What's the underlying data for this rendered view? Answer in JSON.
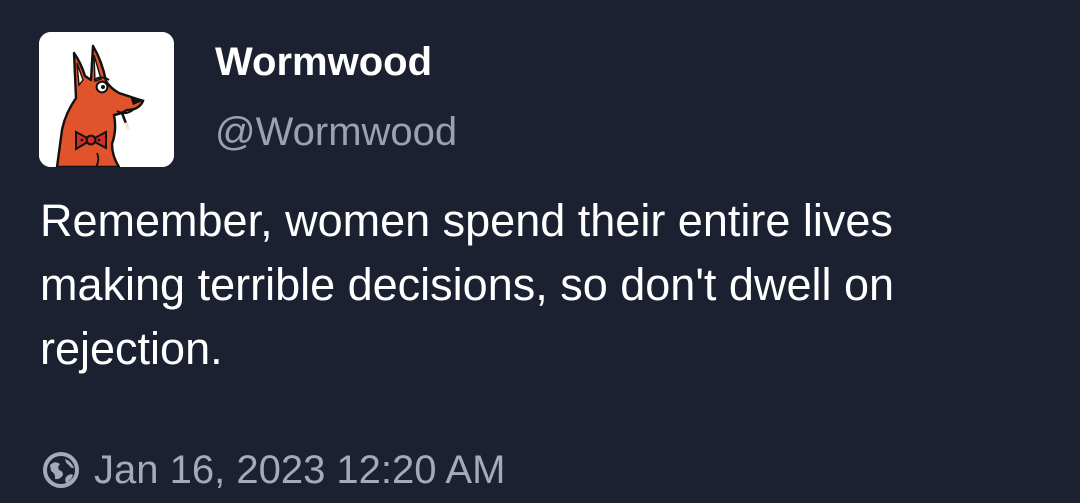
{
  "post": {
    "author": {
      "display_name": "Wormwood",
      "handle": "@Wormwood",
      "avatar_icon": "fox-cartoon-avatar"
    },
    "text": "Remember, women spend their entire lives making terrible decisions, so don't dwell on rejection.",
    "meta": {
      "visibility_icon": "globe-icon",
      "timestamp": "Jan 16, 2023 12:20 AM"
    }
  },
  "colors": {
    "background": "#1b2131",
    "primary_text": "#ffffff",
    "secondary_text": "#9aa2b1",
    "avatar_fox": "#e0532b",
    "avatar_bowtie": "#d42c27"
  }
}
